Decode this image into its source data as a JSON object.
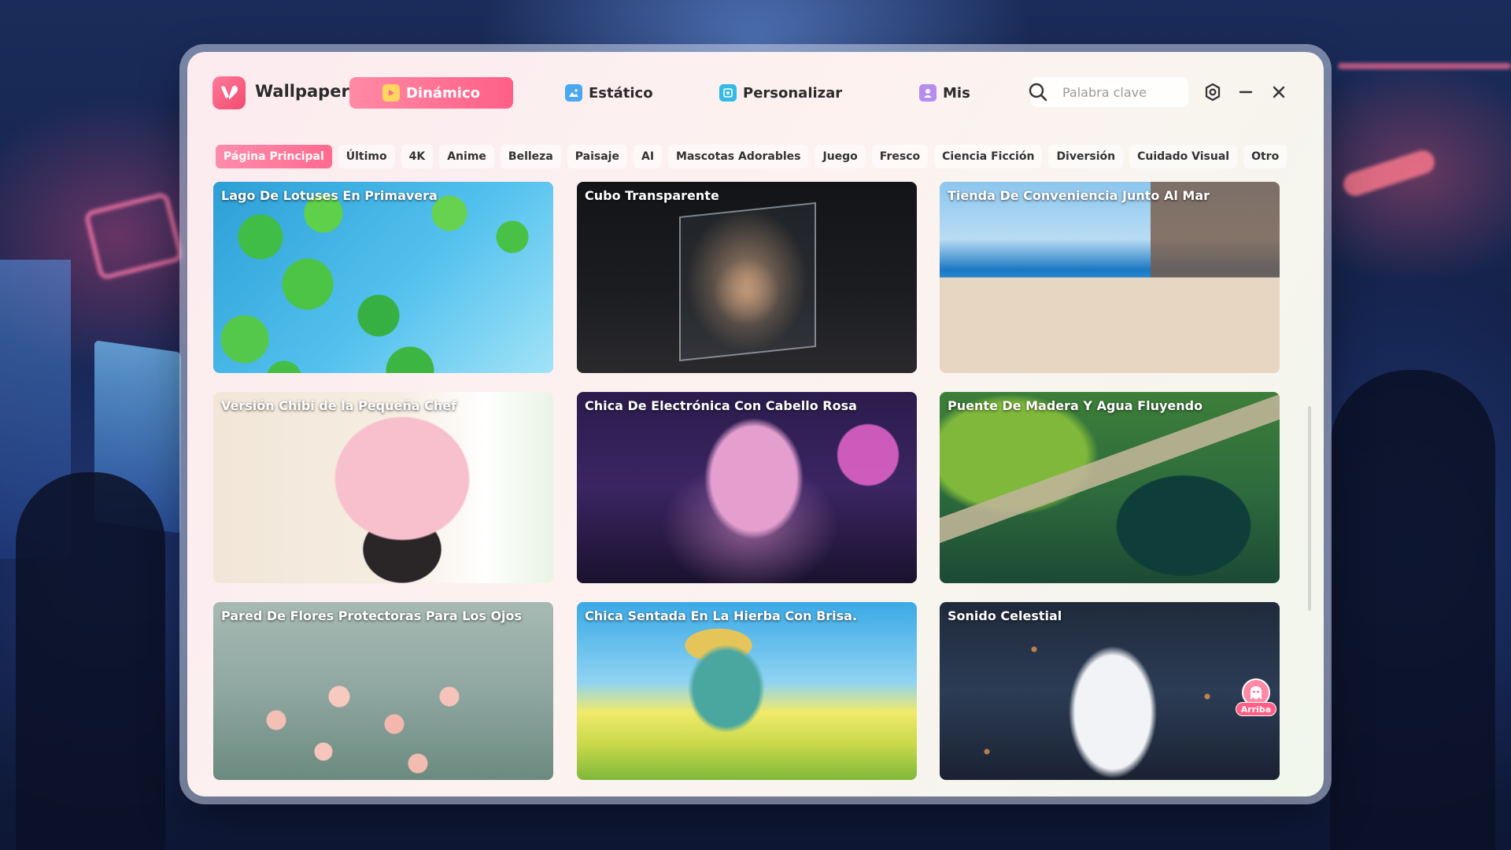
{
  "app": {
    "title": "Wallpaper X"
  },
  "nav": {
    "dynamic": "Dinámico",
    "static": "Estático",
    "customize": "Personalizar",
    "mine": "Mis"
  },
  "search": {
    "placeholder": "Palabra clave"
  },
  "categories": [
    "Página Principal",
    "Último",
    "4K",
    "Anime",
    "Belleza",
    "Paisaje",
    "AI",
    "Mascotas Adorables",
    "Juego",
    "Fresco",
    "Ciencia Ficción",
    "Diversión",
    "Cuidado Visual",
    "Otro"
  ],
  "wallpapers": [
    "Lago De Lotuses En Primavera",
    "Cubo Transparente",
    "Tienda De Conveniencia Junto Al Mar",
    "Versión Chibi de la Pequeña Chef",
    "Chica De Electrónica Con Cabello Rosa",
    "Puente De Madera Y Agua Fluyendo",
    "Pared De Flores Protectoras Para Los Ojos",
    "Chica Sentada En La Hierba Con Brisa.",
    "Sonido Celestial"
  ],
  "back_to_top": "Arriba",
  "colors": {
    "accent": "#ff6b8f",
    "accent_light": "#ff8aa6"
  },
  "icons": {
    "logo": "heart-logo-icon",
    "search": "search-icon",
    "settings": "settings-icon",
    "minimize": "minimize-icon",
    "close": "close-icon"
  }
}
